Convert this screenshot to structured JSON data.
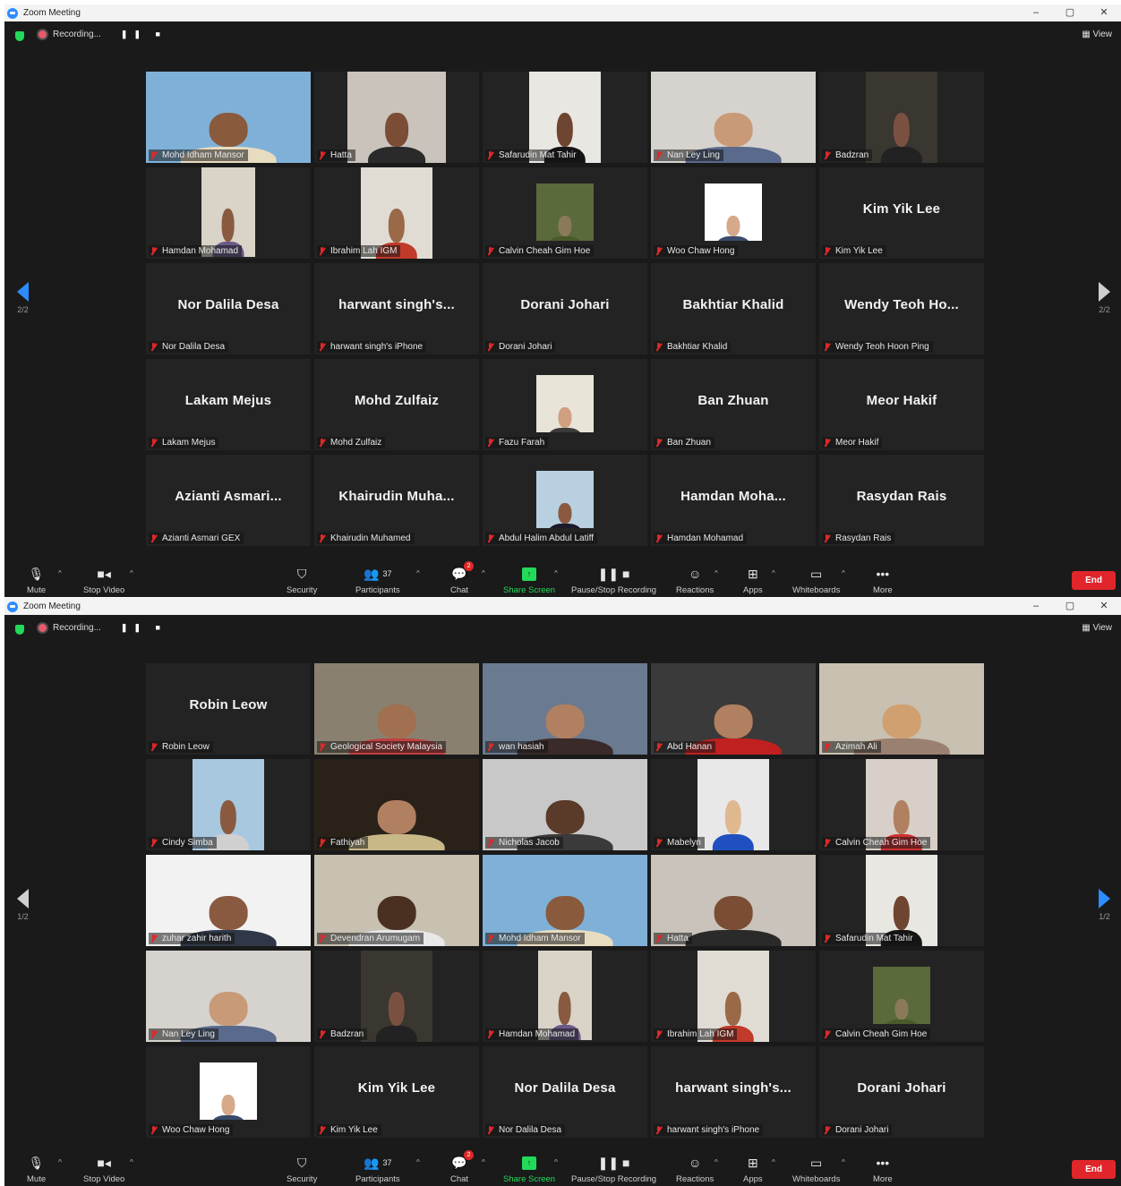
{
  "app_title": "Zoom Meeting",
  "window_controls": [
    "–",
    "▢",
    "✕"
  ],
  "recording_label": "Recording...",
  "recording_controls": "❚❚ ■",
  "view_label": "View",
  "toolbar": {
    "mute": "Mute",
    "stop_video": "Stop Video",
    "security": "Security",
    "participants": "Participants",
    "participants_count": "37",
    "chat": "Chat",
    "chat_badge": "2",
    "share_screen": "Share Screen",
    "pause_stop_recording": "Pause/Stop Recording",
    "reactions": "Reactions",
    "apps": "Apps",
    "whiteboards": "Whiteboards",
    "more": "More",
    "end": "End"
  },
  "windows": [
    {
      "page_left": "2/2",
      "page_right": "2/2",
      "tiles": [
        {
          "label": "Mohd Idham Mansor",
          "video": "full",
          "bg": "#7fb1d8",
          "skin": "#8a5a3c",
          "shirt": "#e8dcc0"
        },
        {
          "label": "Hatta",
          "video": "w110",
          "bg": "#c9c3bb",
          "skin": "#7a4d34",
          "shirt": "#2a2a2a"
        },
        {
          "label": "Safarudin Mat Tahir",
          "video": "w80",
          "bg": "#e9e7e2",
          "skin": "#6e4530",
          "shirt": "#151515"
        },
        {
          "label": "Nan Ley Ling",
          "video": "full",
          "bg": "#d6d3cf",
          "skin": "#c99a78",
          "shirt": "#5a6a8c"
        },
        {
          "label": "Badzran",
          "video": "w80",
          "bg": "#3a3630",
          "skin": "#7a5140",
          "shirt": "#222"
        },
        {
          "label": "Hamdan Mohamad",
          "video": "w60x",
          "bg": "#d9d3c8",
          "skin": "#8a5a40",
          "shirt": "#6a5a88"
        },
        {
          "label": "Ibrahim Lah IGM",
          "video": "w80",
          "bg": "#e0dcd4",
          "skin": "#9a6a48",
          "shirt": "#c23a2a"
        },
        {
          "label": "Calvin Cheah Gim Hoe",
          "video": "w60",
          "bg": "#5a6a3a",
          "skin": "#8a7a5a",
          "shirt": "#4a5a2a"
        },
        {
          "label": "Woo Chaw Hong",
          "video": "w60",
          "bg": "#ffffff",
          "skin": "#d6a98a",
          "shirt": "#3a4a6a"
        },
        {
          "label": "Kim Yik Lee",
          "name": "Kim Yik Lee"
        },
        {
          "label": "Nor Dalila Desa",
          "name": "Nor Dalila Desa"
        },
        {
          "label": "harwant singh's iPhone",
          "name": "harwant  singh's..."
        },
        {
          "label": "Dorani Johari",
          "name": "Dorani Johari"
        },
        {
          "label": "Bakhtiar Khalid",
          "name": "Bakhtiar Khalid"
        },
        {
          "label": "Wendy Teoh Hoon Ping",
          "name": "Wendy  Teoh Ho..."
        },
        {
          "label": "Lakam Mejus",
          "name": "Lakam Mejus"
        },
        {
          "label": "Mohd Zulfaiz",
          "name": "Mohd Zulfaiz"
        },
        {
          "label": "Fazu Farah",
          "video": "w60",
          "bg": "#e8e4d8",
          "skin": "#d0a080",
          "shirt": "#3a3a3a"
        },
        {
          "label": "Ban Zhuan",
          "name": "Ban Zhuan"
        },
        {
          "label": "Meor Hakif",
          "name": "Meor Hakif"
        },
        {
          "label": "Azianti Asmari GEX",
          "name": "Azianti  Asmari..."
        },
        {
          "label": "Khairudin Muhamed",
          "name": "Khairudin  Muha..."
        },
        {
          "label": "Abdul Halim Abdul Latiff",
          "video": "w60",
          "bg": "#b8d0e0",
          "skin": "#8a5a40",
          "shirt": "#1a1a2a"
        },
        {
          "label": "Hamdan Mohamad",
          "name": "Hamdan  Moha..."
        },
        {
          "label": "Rasydan Rais",
          "name": "Rasydan Rais"
        }
      ]
    },
    {
      "page_left": "1/2",
      "page_right": "1/2",
      "tiles": [
        {
          "label": "Robin Leow",
          "name": "Robin Leow"
        },
        {
          "label": "Geological Society Malaysia",
          "video": "full",
          "bg": "#8a8070",
          "skin": "#a07050",
          "shirt": "#c04040",
          "active": true
        },
        {
          "label": "wan hasiah",
          "video": "full",
          "bg": "#6a7a90",
          "skin": "#b08060",
          "shirt": "#3a2a2a"
        },
        {
          "label": "Abd Hanan",
          "video": "full",
          "bg": "#3a3a3a",
          "skin": "#b08060",
          "shirt": "#c02020"
        },
        {
          "label": "Azimah Ali",
          "video": "full",
          "bg": "#c8c0b0",
          "skin": "#d0a070",
          "shirt": "#9a8070"
        },
        {
          "label": "Cindy Simba",
          "video": "w80",
          "bg": "#a8c8e0",
          "skin": "#8a5a40",
          "shirt": "#d0d0d0"
        },
        {
          "label": "Fathiyah",
          "video": "full",
          "bg": "#2a2218",
          "skin": "#b08060",
          "shirt": "#c8b888"
        },
        {
          "label": "Nicholas Jacob",
          "video": "full",
          "bg": "#c8c8c8",
          "skin": "#5a3a28",
          "shirt": "#3a3a3a"
        },
        {
          "label": "Mabelyn",
          "video": "w80",
          "bg": "#e8e8e8",
          "skin": "#e0b890",
          "shirt": "#2050c0"
        },
        {
          "label": "Calvin Cheah Gim Hoe",
          "video": "w80",
          "bg": "#d8d0c8",
          "skin": "#b08060",
          "shirt": "#d03030"
        },
        {
          "label": "zuhar zahir harith",
          "video": "full",
          "bg": "#f2f2f2",
          "skin": "#8a5a40",
          "shirt": "#303848"
        },
        {
          "label": "Devendran Arumugam",
          "video": "full",
          "bg": "#c8c0b0",
          "skin": "#4a3020",
          "shirt": "#e8e8e8"
        },
        {
          "label": "Mohd Idham Mansor",
          "video": "full",
          "bg": "#7fb1d8",
          "skin": "#8a5a3c",
          "shirt": "#e8dcc0"
        },
        {
          "label": "Hatta",
          "video": "full",
          "bg": "#c9c3bb",
          "skin": "#7a4d34",
          "shirt": "#2a2a2a"
        },
        {
          "label": "Safarudin Mat Tahir",
          "video": "w80",
          "bg": "#e9e7e2",
          "skin": "#6e4530",
          "shirt": "#151515"
        },
        {
          "label": "Nan Ley Ling",
          "video": "full",
          "bg": "#d6d3cf",
          "skin": "#c99a78",
          "shirt": "#5a6a8c"
        },
        {
          "label": "Badzran",
          "video": "w80",
          "bg": "#3a3630",
          "skin": "#7a5140",
          "shirt": "#222"
        },
        {
          "label": "Hamdan Mohamad",
          "video": "w60x",
          "bg": "#d9d3c8",
          "skin": "#8a5a40",
          "shirt": "#6a5a88"
        },
        {
          "label": "Ibrahim Lah IGM",
          "video": "w80",
          "bg": "#e0dcd4",
          "skin": "#9a6a48",
          "shirt": "#c23a2a"
        },
        {
          "label": "Calvin Cheah Gim Hoe",
          "video": "w60",
          "bg": "#5a6a3a",
          "skin": "#8a7a5a",
          "shirt": "#4a5a2a"
        },
        {
          "label": "Woo Chaw Hong",
          "video": "w60",
          "bg": "#ffffff",
          "skin": "#d6a98a",
          "shirt": "#3a4a6a"
        },
        {
          "label": "Kim Yik Lee",
          "name": "Kim Yik Lee"
        },
        {
          "label": "Nor Dalila Desa",
          "name": "Nor Dalila Desa"
        },
        {
          "label": "harwant singh's iPhone",
          "name": "harwant  singh's..."
        },
        {
          "label": "Dorani Johari",
          "name": "Dorani Johari"
        }
      ]
    }
  ]
}
